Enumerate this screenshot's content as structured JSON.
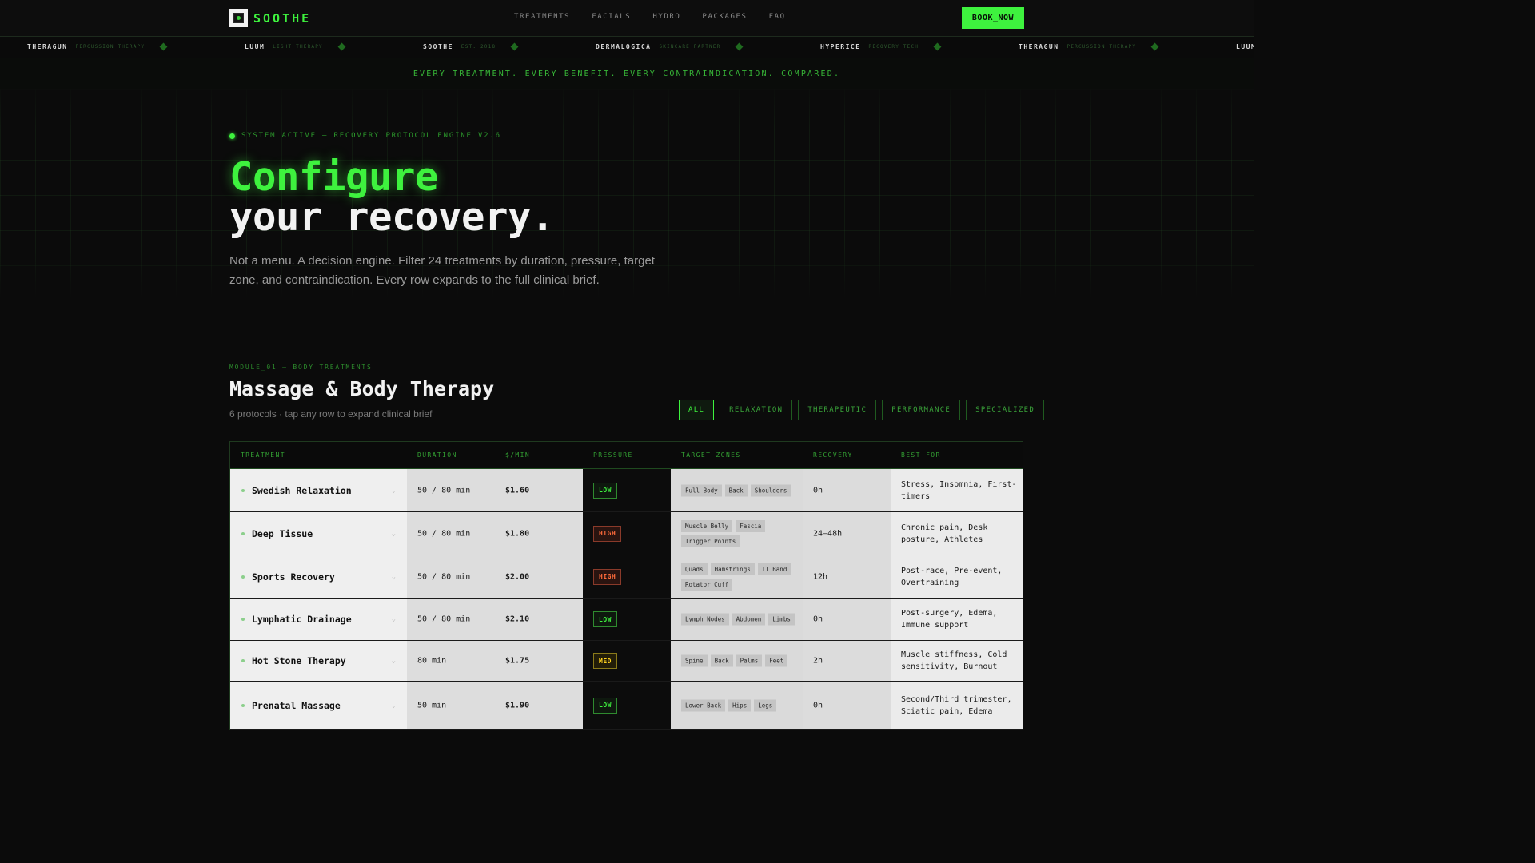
{
  "nav": {
    "logo_text": "SOOTHE",
    "links": [
      "TREATMENTS",
      "FACIALS",
      "HYDRO",
      "PACKAGES",
      "FAQ"
    ],
    "book_label": "BOOK_NOW"
  },
  "ticker": [
    {
      "brand": "THERAGUN",
      "sub": "PERCUSSION THERAPY"
    },
    {
      "brand": "LUUM",
      "sub": "LIGHT THERAPY"
    },
    {
      "brand": "SOOTHE",
      "sub": "EST. 2018"
    },
    {
      "brand": "DERMALOGICA",
      "sub": "SKINCARE PARTNER"
    },
    {
      "brand": "HYPERICE",
      "sub": "RECOVERY TECH"
    },
    {
      "brand": "THERAGUN",
      "sub": "PERCUSSION THERAPY"
    },
    {
      "brand": "LUUM",
      "sub": ""
    }
  ],
  "tagline": "EVERY TREATMENT. EVERY BENEFIT. EVERY CONTRAINDICATION. COMPARED.",
  "hero": {
    "status": "SYSTEM ACTIVE — RECOVERY PROTOCOL ENGINE V2.6",
    "title_line1": "Configure",
    "title_line2": "your recovery.",
    "description": "Not a menu. A decision engine. Filter 24 treatments by duration, pressure, target zone, and contraindication. Every row expands to the full clinical brief."
  },
  "section": {
    "module_label": "MODULE_01 — BODY TREATMENTS",
    "title": "Massage & Body Therapy",
    "subtitle": "6 protocols · tap any row to expand clinical brief",
    "filters": [
      "ALL",
      "RELAXATION",
      "THERAPEUTIC",
      "PERFORMANCE",
      "SPECIALIZED"
    ],
    "active_filter": "ALL"
  },
  "table": {
    "headers": [
      "TREATMENT",
      "DURATION",
      "$/MIN",
      "PRESSURE",
      "TARGET ZONES",
      "RECOVERY",
      "BEST FOR"
    ],
    "rows": [
      {
        "name": "Swedish Relaxation",
        "duration": "50 / 80 min",
        "rate": "$1.60",
        "pressure": "LOW",
        "zones": [
          "Full Body",
          "Back",
          "Shoulders"
        ],
        "recovery": "0h",
        "best_for": "Stress, Insomnia, First-timers"
      },
      {
        "name": "Deep Tissue",
        "duration": "50 / 80 min",
        "rate": "$1.80",
        "pressure": "HIGH",
        "zones": [
          "Muscle Belly",
          "Fascia",
          "Trigger Points"
        ],
        "recovery": "24–48h",
        "best_for": "Chronic pain, Desk posture, Athletes"
      },
      {
        "name": "Sports Recovery",
        "duration": "50 / 80 min",
        "rate": "$2.00",
        "pressure": "HIGH",
        "zones": [
          "Quads",
          "Hamstrings",
          "IT Band",
          "Rotator Cuff"
        ],
        "recovery": "12h",
        "best_for": "Post-race, Pre-event, Overtraining"
      },
      {
        "name": "Lymphatic Drainage",
        "duration": "50 / 80 min",
        "rate": "$2.10",
        "pressure": "LOW",
        "zones": [
          "Lymph Nodes",
          "Abdomen",
          "Limbs"
        ],
        "recovery": "0h",
        "best_for": "Post-surgery, Edema, Immune support"
      },
      {
        "name": "Hot Stone Therapy",
        "duration": "80 min",
        "rate": "$1.75",
        "pressure": "MED",
        "zones": [
          "Spine",
          "Back",
          "Palms",
          "Feet"
        ],
        "recovery": "2h",
        "best_for": "Muscle stiffness, Cold sensitivity, Burnout"
      },
      {
        "name": "Prenatal Massage",
        "duration": "50 min",
        "rate": "$1.90",
        "pressure": "LOW",
        "zones": [
          "Lower Back",
          "Hips",
          "Legs"
        ],
        "recovery": "0h",
        "best_for": "Second/Third trimester, Sciatic pain, Edema"
      }
    ]
  },
  "colors": {
    "accent": "#3ef23e",
    "background": "#0b0b0b",
    "pressure_low": "#3ef23e",
    "pressure_med": "#ffd21f",
    "pressure_high": "#ff6a3a"
  },
  "icons": {
    "row_bullet": "dot-icon",
    "row_expand": "chevron-down-icon",
    "ticker_separator": "diamond-icon",
    "status": "status-led-icon"
  }
}
